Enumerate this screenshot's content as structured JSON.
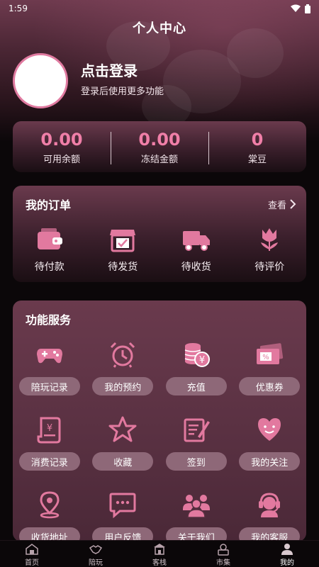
{
  "status_bar": {
    "time": "1:59"
  },
  "header": {
    "title": "个人中心"
  },
  "profile": {
    "login_title": "点击登录",
    "login_subtitle": "登录后使用更多功能"
  },
  "balances": [
    {
      "value": "0.00",
      "label": "可用余额"
    },
    {
      "value": "0.00",
      "label": "冻结金额"
    },
    {
      "value": "0",
      "label": "棠豆"
    }
  ],
  "orders": {
    "title": "我的订单",
    "view_all": "查看",
    "items": [
      {
        "label": "待付款",
        "icon": "wallet-icon"
      },
      {
        "label": "待发货",
        "icon": "store-icon"
      },
      {
        "label": "待收货",
        "icon": "truck-icon"
      },
      {
        "label": "待评价",
        "icon": "tulip-icon"
      }
    ]
  },
  "services": {
    "title": "功能服务",
    "items": [
      {
        "label": "陪玩记录",
        "icon": "gamepad-icon"
      },
      {
        "label": "我的预约",
        "icon": "alarm-clock-icon"
      },
      {
        "label": "充值",
        "icon": "coins-icon"
      },
      {
        "label": "优惠券",
        "icon": "coupon-icon"
      },
      {
        "label": "消费记录",
        "icon": "receipt-icon"
      },
      {
        "label": "收藏",
        "icon": "star-icon"
      },
      {
        "label": "签到",
        "icon": "sign-in-icon"
      },
      {
        "label": "我的关注",
        "icon": "heart-icon"
      },
      {
        "label": "收货地址",
        "icon": "location-pin-icon"
      },
      {
        "label": "用户反馈",
        "icon": "chat-icon"
      },
      {
        "label": "关于我们",
        "icon": "group-icon"
      },
      {
        "label": "我的客服",
        "icon": "customer-service-icon"
      }
    ]
  },
  "tabbar": [
    {
      "label": "首页",
      "icon": "home-icon"
    },
    {
      "label": "陪玩",
      "icon": "handshake-icon"
    },
    {
      "label": "客栈",
      "icon": "inn-icon"
    },
    {
      "label": "市集",
      "icon": "market-icon"
    },
    {
      "label": "我的",
      "icon": "user-icon"
    }
  ],
  "colors": {
    "accent": "#f07fa8",
    "icon": "#e2799f",
    "pill": "#8e6878"
  }
}
